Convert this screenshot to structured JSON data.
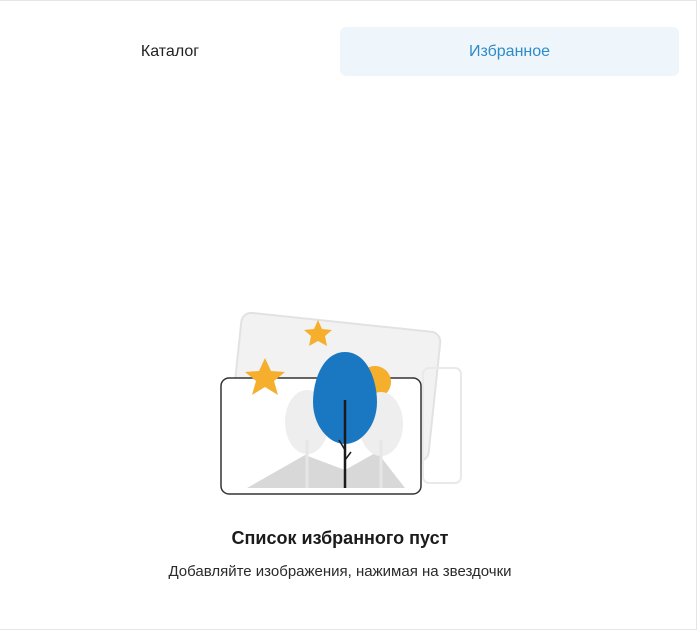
{
  "tabs": [
    {
      "label": "Каталог",
      "active": false
    },
    {
      "label": "Избранное",
      "active": true
    }
  ],
  "empty_state": {
    "title": "Список избранного пуст",
    "subtitle": "Добавляйте изображения, нажимая на звездочки",
    "illustration_icon": "empty-favorites-illustration"
  },
  "colors": {
    "accent": "#2d8bc8",
    "active_tab_bg": "#eef6fc",
    "tree_blue": "#1a78c2",
    "star_orange": "#f6ae2d",
    "sun_orange": "#f6ae2d"
  }
}
